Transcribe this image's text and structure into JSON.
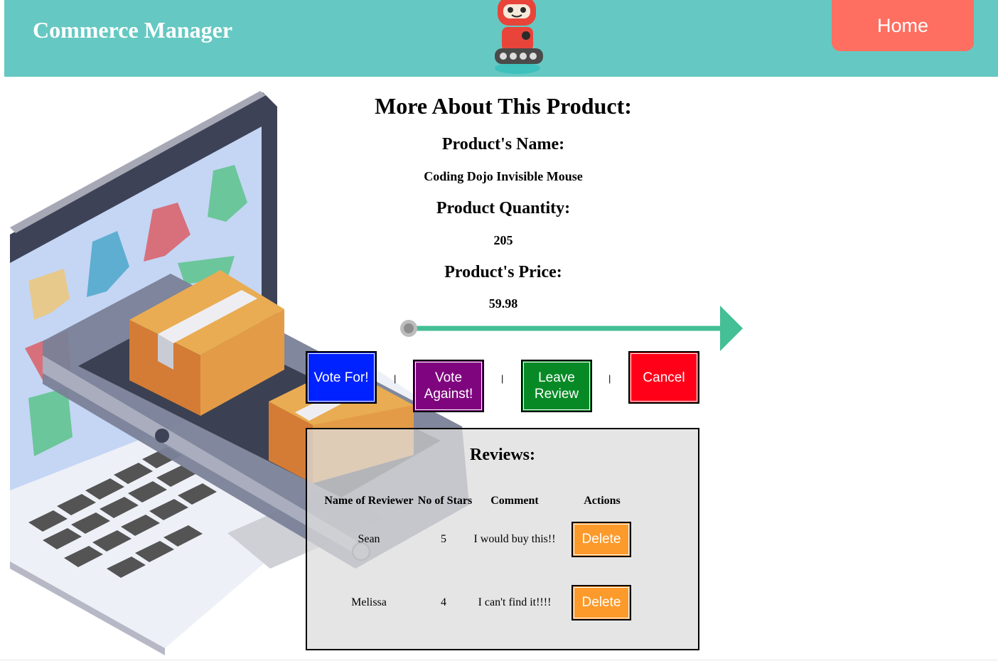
{
  "header": {
    "brand": "Commerce Manager",
    "home_label": "Home",
    "logo_icon": "robot-mascot-icon",
    "background_color": "#66c8c2",
    "home_color": "#fe6f61"
  },
  "product": {
    "heading": "More About This Product:",
    "name_label": "Product's Name:",
    "name_value": "Coding Dojo Invisible Mouse",
    "quantity_label": "Product Quantity:",
    "quantity_value": "205",
    "price_label": "Product's Price:",
    "price_value": "59.98"
  },
  "actions": {
    "vote_for": "Vote For!",
    "vote_against": "Vote Against!",
    "leave_review": "Leave Review",
    "cancel": "Cancel",
    "separator": "|",
    "colors": {
      "vote_for": "#0022ff",
      "vote_against": "#7f057f",
      "leave_review": "#078a26",
      "cancel": "#ff0018"
    }
  },
  "reviews": {
    "heading": "Reviews:",
    "columns": [
      "Name of Reviewer",
      "No of Stars",
      "Comment",
      "Actions"
    ],
    "rows": [
      {
        "name": "Sean",
        "stars": "5",
        "comment": "I would buy this!!",
        "action": "Delete"
      },
      {
        "name": "Melissa",
        "stars": "4",
        "comment": "I can't find it!!!!",
        "action": "Delete"
      }
    ]
  },
  "illustration": {
    "name": "laptop-shopping-illustration-icon",
    "arrow": "arrow-right-icon"
  }
}
